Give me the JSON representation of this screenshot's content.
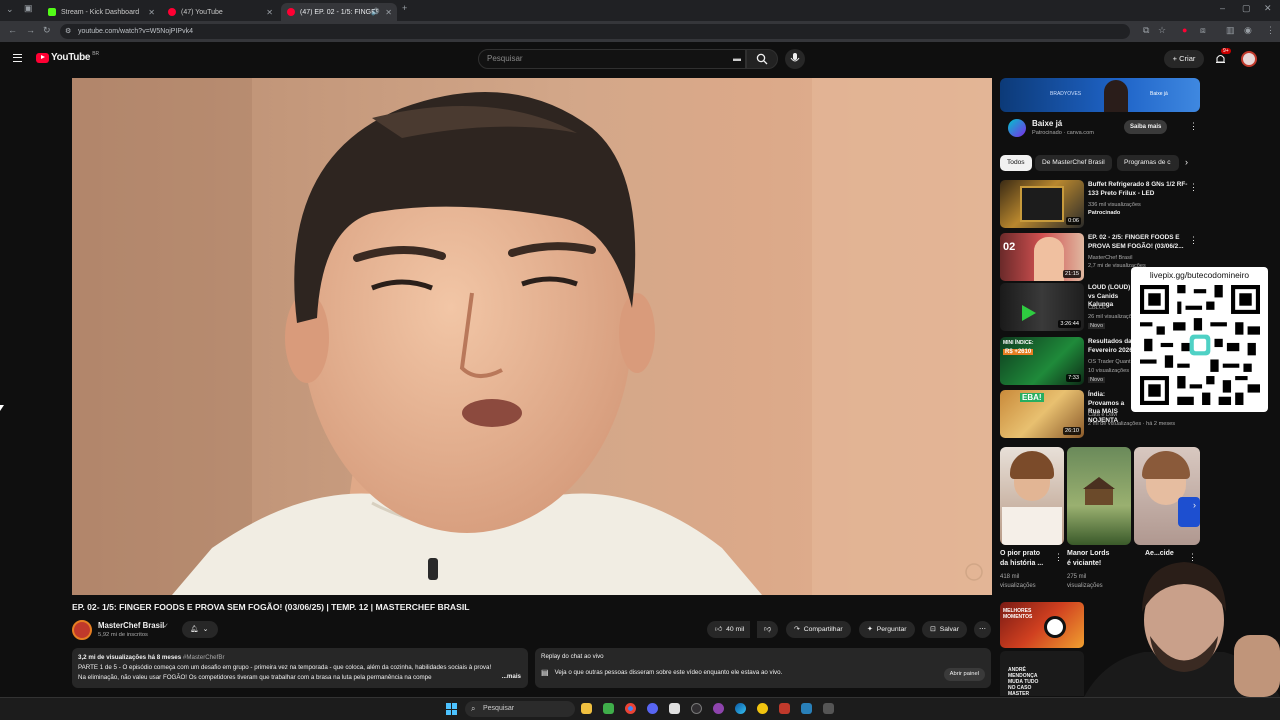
{
  "browser": {
    "tabs": [
      {
        "label": "Stream - Kick Dashboard",
        "color": "#53fc18"
      },
      {
        "label": "(47) YouTube",
        "color": "#ff0033"
      },
      {
        "label": "(47) EP. 02 - 1/5: FINGER FO",
        "color": "#ff0033"
      }
    ],
    "url": "youtube.com/watch?v=W5NojPIPvk4"
  },
  "header": {
    "logo": "YouTube",
    "region": "BR",
    "search_placeholder": "Pesquisar",
    "create_label": "Criar",
    "notif_count": "9+"
  },
  "video": {
    "title": "EP. 02- 1/5: FINGER FOODS E PROVA SEM FOGÃO! (03/06/25) | TEMP. 12 | MASTERCHEF BRASIL",
    "channel": "MasterChef Brasil",
    "subscribers": "5,92 mi de inscritos",
    "likes": "40 mil",
    "share_label": "Compartilhar",
    "ask_label": "Perguntar",
    "save_label": "Salvar",
    "views_line": "3,2 mi de visualizações  há 8 meses",
    "hashtag": "#MasterChefBr",
    "description": "PARTE 1 de 5 - O episódio começa com um desafio em grupo - primeira vez na temporada - que coloca, além da cozinha, habilidades sociais à prova! Na eliminação, não valeu usar FOGÃO! Os competidores tiveram que trabalhar com a brasa na luta pela permanência na compe",
    "more_label": "...mais",
    "chat_title": "Replay do chat ao vivo",
    "chat_text": "Veja o que outras pessoas disseram sobre este vídeo enquanto ele estava ao vivo.",
    "chat_button": "Abrir painel"
  },
  "ad": {
    "title": "Baixe já",
    "sponsor_line": "Patrocinado · canva.com",
    "cta": "Saiba mais",
    "banner_left": "BRADYOVES",
    "banner_right": "Baixe já"
  },
  "chips": [
    "Todos",
    "De MasterChef Brasil",
    "Programas de c"
  ],
  "recommendations": [
    {
      "title": "Buffet Refrigerado 8 GNs 1/2 RF-133 Preto Frilux - LED",
      "meta1": "336 mil visualizações",
      "meta2": "Patrocinado",
      "duration": "0:06"
    },
    {
      "title": "EP. 02 - 2/5: FINGER FOODS E PROVA SEM FOGÃO! (03/06/2...",
      "meta1": "MasterChef Brasil",
      "meta2": "2,7 mi de visualizações",
      "duration": "21:15"
    },
    {
      "title": "LOUD (LOUD) vs Canids Kalunga",
      "meta1": "CBLOL",
      "meta2": "26 mil visualizações",
      "badge": "Novo",
      "duration": "3:26:44"
    },
    {
      "title": "Resultados da Fevereiro 2026",
      "meta1": "OS Trader Quantitativo",
      "meta2": "10 visualizações",
      "badge": "Novo",
      "duration": "7:33"
    },
    {
      "title": "Índia: Provamos a Rua MAIS NOJENTA",
      "meta1": "Cata e Davi",
      "meta2": "2 mi de visualizações · há 2 meses",
      "duration": "26:10"
    }
  ],
  "shorts": [
    {
      "title": "O pior prato da história ...",
      "views": "418 mil visualizações"
    },
    {
      "title": "Manor Lords é viciante!",
      "views": "275 mil visualizações"
    },
    {
      "title": "Ae...cide",
      "views": ""
    }
  ],
  "overlay": {
    "livepix_url": "livepix.gg/butecodomineiro"
  },
  "promo_text": "ANDRÉ MENDONÇA MUDA TUDO NO CASO MASTER",
  "mini_thumb_caption": "MELHORES MOMENTOS",
  "thumb_texts": {
    "rec2_number": "02",
    "rec4_top": "MINI ÍNDICE:",
    "rec4_value": "R$ +2610",
    "rec5_top": "EBA!"
  },
  "taskbar": {
    "search_label": "Pesquisar"
  },
  "colors": {
    "yt_red": "#ff0033",
    "bg": "#0f0f0f",
    "surface": "#272727"
  }
}
